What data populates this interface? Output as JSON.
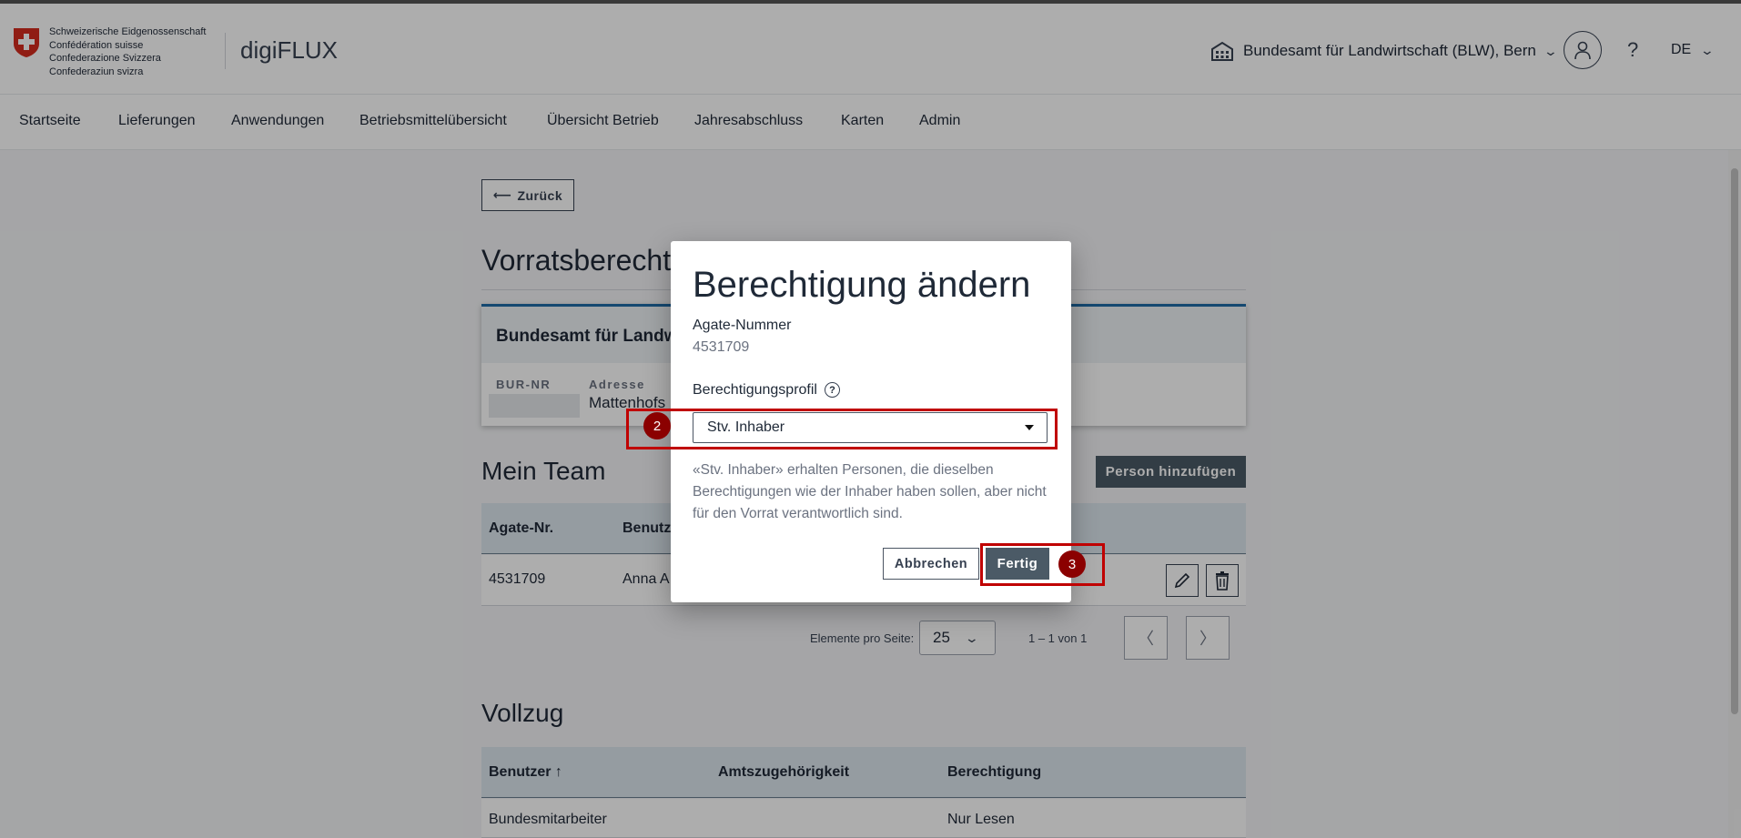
{
  "header": {
    "confederation_lines": [
      "Schweizerische Eidgenossenschaft",
      "Confédération suisse",
      "Confederazione Svizzera",
      "Confederaziun svizra"
    ],
    "app_name": "digiFLUX",
    "organization": "Bundesamt für Landwirtschaft (BLW), Bern",
    "help_label": "?",
    "language": "DE"
  },
  "nav": {
    "items": [
      "Startseite",
      "Lieferungen",
      "Anwendungen",
      "Betriebsmittelübersicht",
      "Übersicht Betrieb",
      "Jahresabschluss",
      "Karten",
      "Admin"
    ]
  },
  "page": {
    "back_label": "Zurück",
    "title": "Vorratsberecht",
    "card": {
      "org_name": "Bundesamt für Landw",
      "bur_label": "BUR-NR",
      "address_label": "Adresse",
      "address_value": "Mattenhofs"
    }
  },
  "team": {
    "title": "Mein Team",
    "add_button": "Person hinzufügen",
    "columns": [
      "Agate-Nr.",
      "Benutze"
    ],
    "rows": [
      {
        "agate": "4531709",
        "user": "Anna A"
      }
    ],
    "pager": {
      "items_per_page_label": "Elemente pro Seite:",
      "page_size": "25",
      "range": "1 – 1 von 1",
      "prev": "〈",
      "next": "〉"
    }
  },
  "vollzug": {
    "title": "Vollzug",
    "columns": [
      "Benutzer ↑",
      "Amtszugehörigkeit",
      "Berechtigung"
    ],
    "rows": [
      {
        "user": "Bundesmitarbeiter",
        "affiliation": "",
        "permission": "Nur Lesen"
      }
    ]
  },
  "dialog": {
    "title": "Berechtigung ändern",
    "agate_label": "Agate-Nummer",
    "agate_value": "4531709",
    "profile_label": "Berechtigungsprofil",
    "profile_help": "?",
    "profile_selected": "Stv. Inhaber",
    "hint": "«Stv. Inhaber» erhalten Personen, die dieselben Berechtigungen wie der Inhaber haben sollen, aber nicht für den Vorrat verantwortlich sind.",
    "cancel_label": "Abbrechen",
    "done_label": "Fertig"
  },
  "annotations": {
    "badge_select": "2",
    "badge_done": "3",
    "color": "#c00000"
  },
  "colors": {
    "accent": "#1e6aa6",
    "primary_button": "#4b5a66",
    "table_header": "#dce6ee"
  }
}
